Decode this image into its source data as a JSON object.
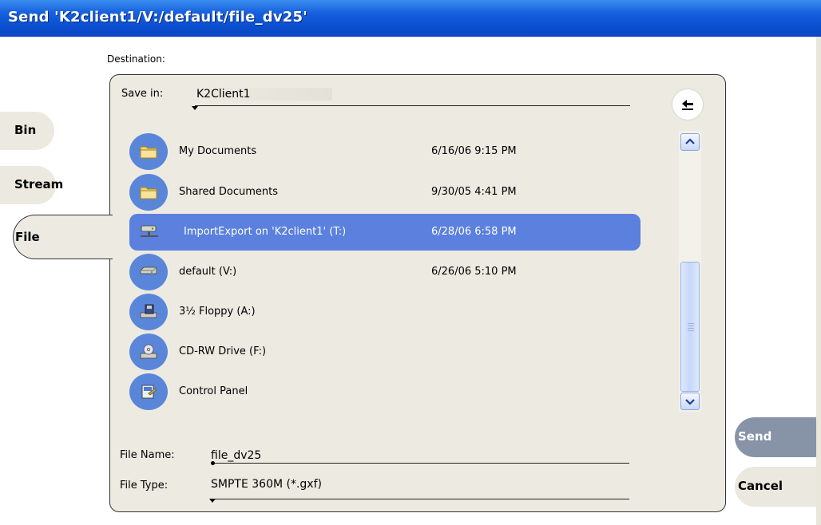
{
  "window": {
    "title": "Send 'K2client1/V:/default/file_dv25'"
  },
  "destination_label": "Destination:",
  "tabs": [
    {
      "label": "Bin"
    },
    {
      "label": "Stream"
    },
    {
      "label": "File",
      "selected": true
    }
  ],
  "save_in": {
    "label": "Save in:",
    "value": "K2Client1"
  },
  "files": [
    {
      "name": "My Documents",
      "date": "6/16/06 9:15 PM",
      "icon": "folder-icon"
    },
    {
      "name": "Shared Documents",
      "date": "9/30/05 4:41 PM",
      "icon": "folder-icon"
    },
    {
      "name": "ImportExport on 'K2client1' (T:)",
      "date": "6/28/06 6:58 PM",
      "icon": "network-drive-icon",
      "selected": true
    },
    {
      "name": "default (V:)",
      "date": "6/26/06 5:10 PM",
      "icon": "hard-drive-icon"
    },
    {
      "name": "3½ Floppy (A:)",
      "date": "",
      "icon": "floppy-drive-icon"
    },
    {
      "name": "CD-RW Drive (F:)",
      "date": "",
      "icon": "cd-drive-icon"
    },
    {
      "name": "Control Panel",
      "date": "",
      "icon": "control-panel-icon"
    }
  ],
  "file_name": {
    "label": "File Name:",
    "value": "file_dv25"
  },
  "file_type": {
    "label": "File Type:",
    "value": "SMPTE 360M (*.gxf)"
  },
  "buttons": {
    "send": "Send",
    "cancel": "Cancel"
  },
  "colors": {
    "titlebar": "#0a4fd0",
    "selection": "#5b80dd",
    "icon_circle": "#5a86da",
    "send_button": "#8793a7"
  }
}
